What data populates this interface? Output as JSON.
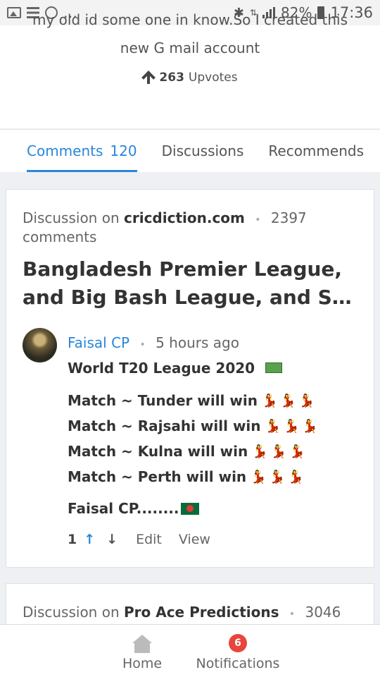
{
  "status_bar": {
    "time": "17:36",
    "battery": "82%"
  },
  "post": {
    "body_line1": "my old id some one in know.So I created this",
    "body_line2": "new G mail account",
    "upvote_count": "263",
    "upvote_label": "Upvotes"
  },
  "tabs": [
    {
      "label": "Comments",
      "count": "120"
    },
    {
      "label": "Discussions"
    },
    {
      "label": "Recommends"
    }
  ],
  "cards": [
    {
      "prefix": "Discussion on",
      "site": "cricdiction.com",
      "comments_count": "2397",
      "comments_label": "comments",
      "headline_line1": "Bangladesh Premier League,",
      "headline_line2": "and Big Bash League, and Supe...",
      "comment": {
        "author": "Faisal CP",
        "time": "5 hours ago",
        "title": "World T20 League 2020",
        "lines": [
          "Match ~ Tunder will win",
          "Match ~ Rajsahi will win",
          "Match ~ Kulna will win",
          "Match ~ Perth will win"
        ],
        "signature": "Faisal CP........",
        "vote_count": "1",
        "edit_label": "Edit",
        "view_label": "View"
      }
    },
    {
      "prefix": "Discussion on",
      "site": "Pro Ace Predictions",
      "comments_count": "3046"
    }
  ],
  "bottom_nav": {
    "home_label": "Home",
    "notifications_label": "Notifications",
    "notifications_badge": "6"
  },
  "colors": {
    "accent": "#2a86d8",
    "badge": "#e8453c"
  }
}
